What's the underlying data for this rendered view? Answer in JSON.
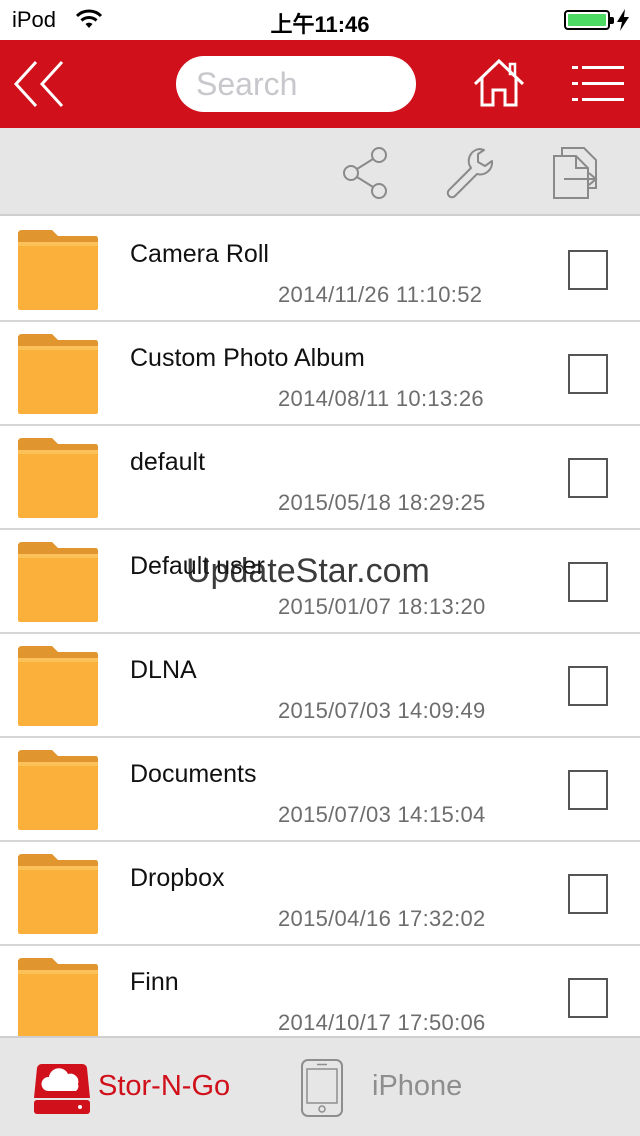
{
  "status_bar": {
    "carrier": "iPod",
    "time": "上午11:46"
  },
  "nav": {
    "back_icon": "double-chevron-left-icon",
    "search_placeholder": "Search",
    "home_icon": "home-icon",
    "menu_icon": "menu-icon"
  },
  "toolbar": {
    "share_icon": "share-icon",
    "wrench_icon": "wrench-icon",
    "move_icon": "file-move-icon"
  },
  "files": [
    {
      "name": "Camera Roll",
      "date": "2014/11/26 11:10:52",
      "checked": false
    },
    {
      "name": "Custom Photo Album",
      "date": "2014/08/11 10:13:26",
      "checked": false
    },
    {
      "name": "default",
      "date": "2015/05/18 18:29:25",
      "checked": false
    },
    {
      "name": "Default user",
      "date": "2015/01/07 18:13:20",
      "checked": false
    },
    {
      "name": "DLNA",
      "date": "2015/07/03 14:09:49",
      "checked": false
    },
    {
      "name": "Documents",
      "date": "2015/07/03 14:15:04",
      "checked": false
    },
    {
      "name": "Dropbox",
      "date": "2015/04/16 17:32:02",
      "checked": false
    },
    {
      "name": "Finn",
      "date": "2014/10/17 17:50:06",
      "checked": false
    }
  ],
  "watermark": "UpdateStar.com",
  "tabs": [
    {
      "label": "Stor-N-Go",
      "active": true,
      "icon": "cloud-drive-icon"
    },
    {
      "label": "iPhone",
      "active": false,
      "icon": "iphone-icon"
    }
  ],
  "colors": {
    "brand_red": "#d0101a",
    "folder_yellow": "#fbb03b",
    "battery_green": "#4cd964",
    "inactive_gray": "#8e8e8e"
  }
}
